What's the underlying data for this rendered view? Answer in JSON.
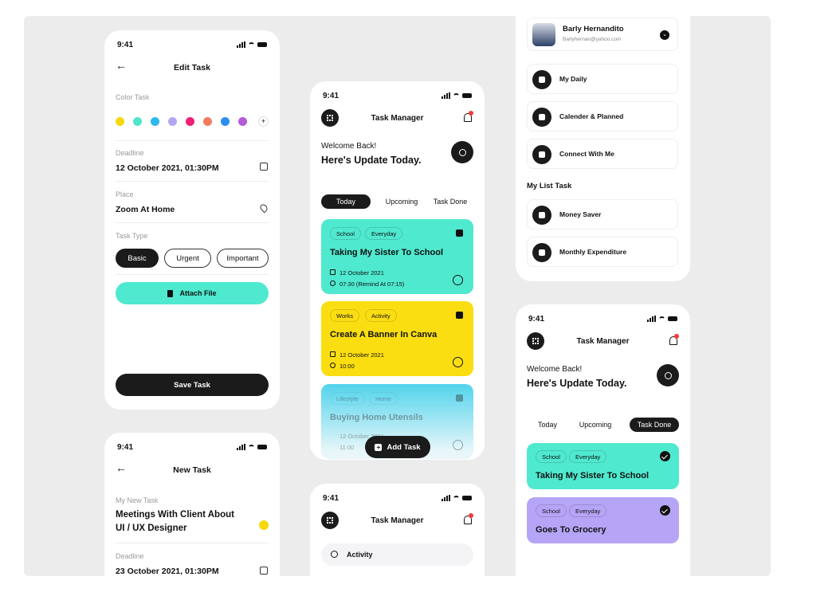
{
  "status_time": "9:41",
  "edit_task": {
    "title": "Edit Task",
    "color_label": "Color Task",
    "colors": [
      "#f5d90a",
      "#4fe5cb",
      "#2cb9ee",
      "#b4a5f4",
      "#f21f75",
      "#f17c5d",
      "#2d8ef0",
      "#b25ad8"
    ],
    "add_color": "+",
    "deadline_label": "Deadline",
    "deadline_value": "12 October 2021,  01:30PM",
    "place_label": "Place",
    "place_value": "Zoom At Home",
    "type_label": "Task Type",
    "types": [
      "Basic",
      "Urgent",
      "Important"
    ],
    "attach_label": "Attach File",
    "save_label": "Save Task"
  },
  "new_task": {
    "title": "New Task",
    "name_label": "My New Task",
    "name_line1": "Meetings With Client About",
    "name_line2": "UI / UX Designer",
    "deadline_label": "Deadline",
    "deadline_value": "23 October 2021,  01:30PM"
  },
  "home": {
    "app_title": "Task Manager",
    "welcome": "Welcome Back!",
    "headline": "Here's Update Today.",
    "tabs": [
      "Today",
      "Upcoming",
      "Task Done"
    ],
    "cards": [
      {
        "tags": [
          "School",
          "Everyday"
        ],
        "title": "Taking My Sister To School",
        "date": "12 October 2021",
        "time": "07:30 (Remind At 07:15)",
        "color": "#4fe9cf"
      },
      {
        "tags": [
          "Works",
          "Activity"
        ],
        "title": "Create A Banner In Canva",
        "date": "12 October 2021",
        "time": "10:00",
        "color": "#fbde12"
      },
      {
        "tags": [
          "Lifestyle",
          "Home"
        ],
        "title": "Buying Home Utensils",
        "date": "12 October 2021",
        "time": "11:00",
        "color": "#3fcfea"
      }
    ],
    "add_task_label": "Add Task"
  },
  "search_screen": {
    "app_title": "Task Manager",
    "search_value": "Activity"
  },
  "profile": {
    "name": "Barly Hernandito",
    "email": "Barlyhernan@yahoo.com",
    "menu": [
      "My Daily",
      "Calender & Planned",
      "Connect With Me"
    ],
    "list_heading": "My List Task",
    "lists": [
      "Money Saver",
      "Monthly Expenditure"
    ]
  },
  "done_screen": {
    "app_title": "Task Manager",
    "welcome": "Welcome Back!",
    "headline": "Here's Update Today.",
    "tabs": [
      "Today",
      "Upcoming",
      "Task Done"
    ],
    "cards": [
      {
        "tags": [
          "School",
          "Everyday"
        ],
        "title": "Taking My Sister To School",
        "color": "#4fe9cf"
      },
      {
        "tags": [
          "School",
          "Everyday"
        ],
        "title": "Goes To Grocery",
        "color": "#b6a5f6"
      }
    ]
  }
}
